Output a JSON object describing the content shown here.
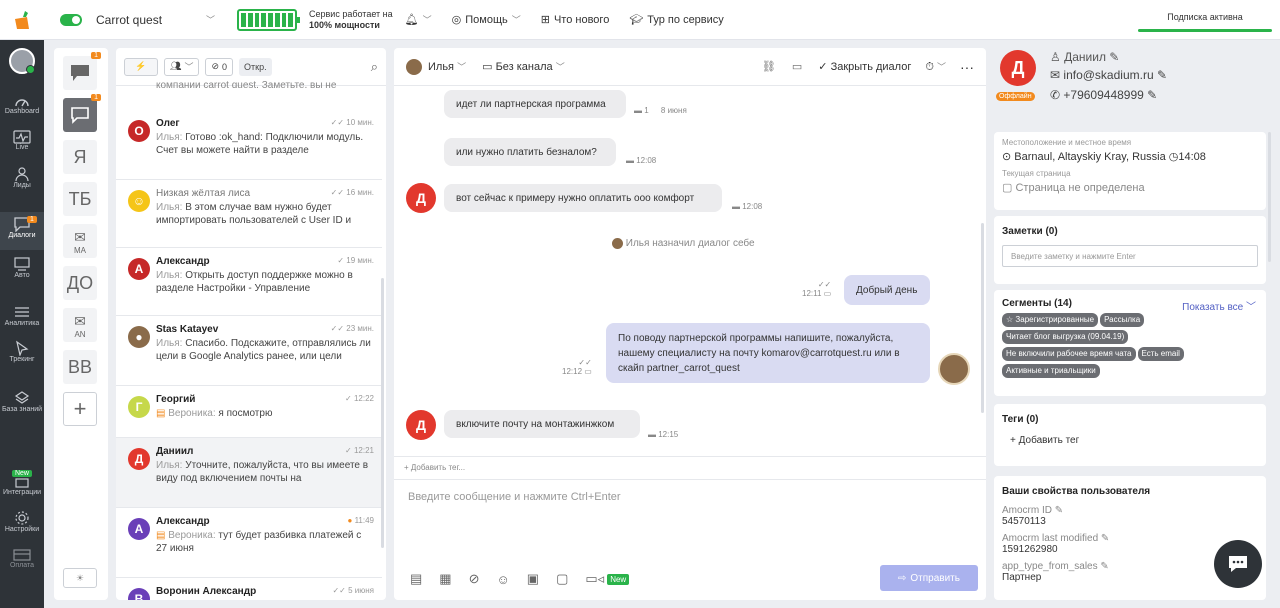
{
  "topbar": {
    "project": "Carrot quest",
    "service_line1": "Сервис работает на",
    "service_line2": "100% мощности",
    "help": "Помощь",
    "whats_new": "Что нового",
    "tour": "Тур по сервису",
    "subscription": "Подписка активна"
  },
  "leftnav": {
    "dashboard": "Dashboard",
    "live": "Live",
    "leads": "Лиды",
    "dialogs": "Диалоги",
    "dialogs_badge": "1",
    "auto": "Авто",
    "analytics": "Аналитика",
    "tracking": "Трекинг",
    "knowledge": "База знаний",
    "integrations_new": "New",
    "integrations": "Интеграции",
    "settings": "Настройки",
    "payment": "Оплата"
  },
  "channels": {
    "badge1": "1",
    "badge2": "1",
    "items": [
      {
        "letter": "Я",
        "sub": ""
      },
      {
        "letter": "ТБ",
        "sub": ""
      },
      {
        "letter": "",
        "sub": "MA"
      },
      {
        "letter": "ДО",
        "sub": ""
      },
      {
        "letter": "",
        "sub": "AN"
      },
      {
        "letter": "ВВ",
        "sub": ""
      }
    ],
    "add": "+"
  },
  "convlist": {
    "tag_count": "0",
    "filter": "Откр.",
    "partial": "компании carrot quest. Заметьте, вы не",
    "items": [
      {
        "initial": "О",
        "color": "#c62828",
        "name": "Олег",
        "time": "10 мин.",
        "who": "Илья:",
        "text": "Готово :ok_hand: Подключили модуль. Счет вы можете найти в разделе"
      },
      {
        "initial": "",
        "color": "#f5c518",
        "name": "Низкая жёлтая лиса",
        "time": "16 мин.",
        "who": "Илья:",
        "text": "В этом случае вам нужно будет импортировать пользователей с User ID и"
      },
      {
        "initial": "А",
        "color": "#c62828",
        "name": "Александр",
        "time": "19 мин.",
        "who": "Илья:",
        "text": "Открыть доступ поддержке можно в разделе Настройки - Управление"
      },
      {
        "initial": "",
        "color": "#8a6b4a",
        "name": "Stas Katayev",
        "time": "23 мин.",
        "who": "Илья:",
        "text": "Спасибо. Подскажите, отправлялись ли цели в Google Analytics ранее, или цели"
      },
      {
        "initial": "Г",
        "color": "#c6d84a",
        "name": "Георгий",
        "time": "12:22",
        "who": "Вероника:",
        "text": "я посмотрю"
      },
      {
        "initial": "Д",
        "color": "#e2382d",
        "name": "Даниил",
        "time": "12:21",
        "who": "Илья:",
        "text": "Уточните, пожалуйста, что вы имеете в виду под включением почты на"
      },
      {
        "initial": "А",
        "color": "#6a3fb8",
        "name": "Александр",
        "time": "11:49",
        "who": "Вероника:",
        "text": "тут будет разбивка платежей с 27 июня"
      },
      {
        "initial": "В",
        "color": "#6a3fb8",
        "name": "Воронин Александр",
        "time": "5 июня",
        "who": "",
        "text": ""
      }
    ]
  },
  "chat": {
    "agent": "Илья",
    "channel": "Без канала",
    "close": "Закрыть диалог",
    "messages": [
      {
        "text": "идет ли партнерская программа",
        "time": "8 июня"
      },
      {
        "text": "или нужно платить безналом?",
        "time": "12:08"
      },
      {
        "text": "вот сейчас к примеру нужно оплатить ооо комфорт",
        "time": "12:08"
      },
      {
        "text": "Илья назначил диалог себе",
        "time": ""
      },
      {
        "text": "Добрый день",
        "time": "12:11"
      },
      {
        "text": "По поводу партнерской программы напишите, пожалуйста, нашему специалисту на почту komarov@carrotquest.ru или в скайп partner_carrot_quest",
        "time": "12:12"
      },
      {
        "text": "включите почту на монтажинжком",
        "time": "12:15"
      }
    ],
    "avatar_letter": "Д",
    "add_tag": "+ Добавить тег...",
    "input_placeholder": "Введите сообщение и нажмите Ctrl+Enter",
    "new_badge": "New",
    "send": "Отправить"
  },
  "user": {
    "letter": "Д",
    "status": "Оффлайн",
    "name": "Даниил",
    "email": "info@skadium.ru",
    "phone": "+79609448999",
    "location_label": "Местоположение и местное время",
    "location": "Barnaul, Altayskiy Kray, Russia",
    "local_time": "14:08",
    "page_label": "Текущая страница",
    "page": "Страница не определена",
    "notes_title": "Заметки (0)",
    "notes_placeholder": "Введите заметку и нажмите Enter",
    "segments_title": "Сегменты (14)",
    "show_all": "Показать все",
    "segments": [
      "Зарегистрированные",
      "Рассылка",
      "Читает блог выгрузка (09.04.19)",
      "Не включили рабочее время чата",
      "Есть email",
      "Активные и триальщики"
    ],
    "tags_title": "Теги (0)",
    "add_tag": "+ Добавить тег",
    "props_title": "Ваши свойства пользователя",
    "props": [
      {
        "label": "Amocrm ID",
        "value": "54570113"
      },
      {
        "label": "Amocrm last modified",
        "value": "1591262980"
      },
      {
        "label": "app_type_from_sales",
        "value": "Партнер"
      }
    ]
  },
  "colors": {
    "accent": "#2ab34a",
    "red": "#e2382d",
    "send": "#aab2ee"
  }
}
